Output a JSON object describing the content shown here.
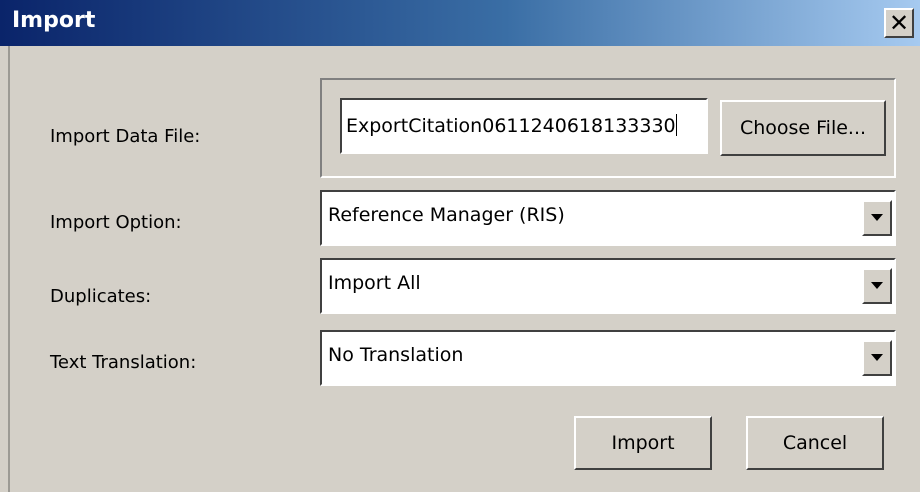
{
  "window": {
    "title": "Import",
    "close_symbol": "✕",
    "close_icon": "close-icon"
  },
  "fields": {
    "data_file_label": "Import Data File:",
    "data_file_value": "ExportCitation0611240618133330",
    "choose_file_label": "Choose File...",
    "import_option_label": "Import Option:",
    "import_option_value": "Reference Manager (RIS)",
    "duplicates_label": "Duplicates:",
    "duplicates_value": "Import All",
    "text_translation_label": "Text Translation:",
    "text_translation_value": "No Translation"
  },
  "buttons": {
    "import_label": "Import",
    "cancel_label": "Cancel"
  },
  "colors": {
    "title_gradient_start": "#0a246a",
    "title_gradient_end": "#a6caf0",
    "dialog_background": "#d4d0c8"
  }
}
